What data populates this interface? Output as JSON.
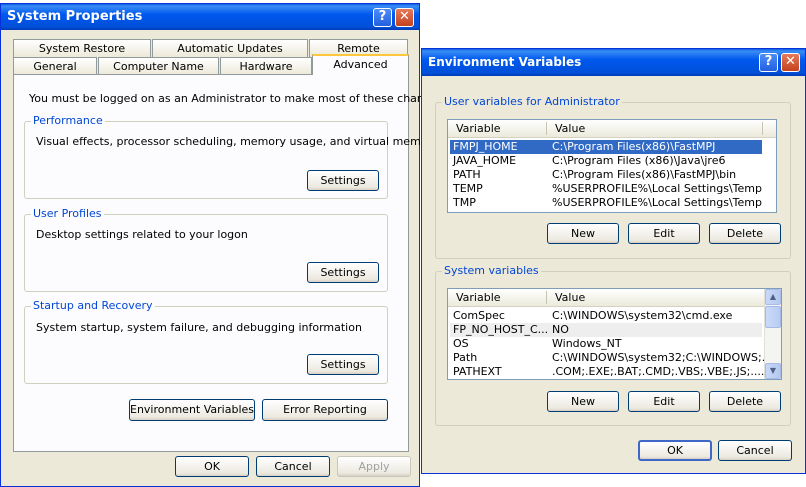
{
  "system_properties": {
    "title": "System Properties",
    "help_glyph": "?",
    "close_glyph": "✕",
    "tabs_back": [
      "System Restore",
      "Automatic Updates",
      "Remote"
    ],
    "tabs_front": [
      "General",
      "Computer Name",
      "Hardware",
      "Advanced"
    ],
    "active_tab": "Advanced",
    "admin_note": "You must be logged on as an Administrator to make most of these changes.",
    "performance": {
      "legend": "Performance",
      "text": "Visual effects, processor scheduling, memory usage, and virtual memory",
      "button": "Settings"
    },
    "user_profiles": {
      "legend": "User Profiles",
      "text": "Desktop settings related to your logon",
      "button": "Settings"
    },
    "startup": {
      "legend": "Startup and Recovery",
      "text": "System startup, system failure, and debugging information",
      "button": "Settings"
    },
    "env_button": "Environment Variables",
    "error_button": "Error Reporting",
    "ok": "OK",
    "cancel": "Cancel",
    "apply": "Apply"
  },
  "env_vars": {
    "title": "Environment Variables",
    "help_glyph": "?",
    "close_glyph": "✕",
    "user_group": "User variables for Administrator",
    "user_columns": [
      "Variable",
      "Value"
    ],
    "user_rows": [
      {
        "variable": "FMPJ_HOME",
        "value": "C:\\Program Files(x86)\\FastMPJ",
        "selected": true
      },
      {
        "variable": "JAVA_HOME",
        "value": "C:\\Program Files (x86)\\Java\\jre6",
        "selected": false
      },
      {
        "variable": "PATH",
        "value": "C:\\Program Files(x86)\\FastMPJ\\bin",
        "selected": false
      },
      {
        "variable": "TEMP",
        "value": "%USERPROFILE%\\Local Settings\\Temp",
        "selected": false
      },
      {
        "variable": "TMP",
        "value": "%USERPROFILE%\\Local Settings\\Temp",
        "selected": false
      }
    ],
    "user_buttons": [
      "New",
      "Edit",
      "Delete"
    ],
    "system_group": "System variables",
    "system_columns": [
      "Variable",
      "Value"
    ],
    "system_rows": [
      {
        "variable": "ComSpec",
        "value": "C:\\WINDOWS\\system32\\cmd.exe"
      },
      {
        "variable": "FP_NO_HOST_C...",
        "value": "NO"
      },
      {
        "variable": "OS",
        "value": "Windows_NT"
      },
      {
        "variable": "Path",
        "value": "C:\\WINDOWS\\system32;C:\\WINDOWS;..."
      },
      {
        "variable": "PATHEXT",
        "value": ".COM;.EXE;.BAT;.CMD;.VBS;.VBE;.JS;...."
      }
    ],
    "system_buttons": [
      "New",
      "Edit",
      "Delete"
    ],
    "ok": "OK",
    "cancel": "Cancel"
  }
}
